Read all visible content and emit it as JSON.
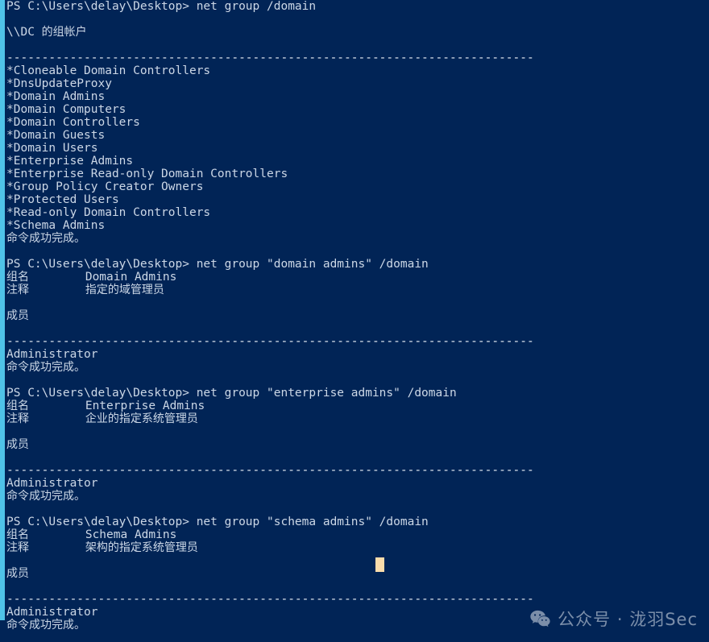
{
  "terminal": {
    "app": "Windows PowerShell",
    "prompt": "PS C:\\Users\\delay\\Desktop>",
    "background_color": "#012456",
    "foreground_color": "#ccd7e6",
    "highlight_strip_color": "#4fc3e8",
    "cursor_color": "#fadcab",
    "separator": "---------------------------------------------------------------------------",
    "lines": [
      "PS C:\\Users\\delay\\Desktop> net group /domain",
      "",
      "\\\\DC 的组帐户",
      "",
      "---------------------------------------------------------------------------",
      "*Cloneable Domain Controllers",
      "*DnsUpdateProxy",
      "*Domain Admins",
      "*Domain Computers",
      "*Domain Controllers",
      "*Domain Guests",
      "*Domain Users",
      "*Enterprise Admins",
      "*Enterprise Read-only Domain Controllers",
      "*Group Policy Creator Owners",
      "*Protected Users",
      "*Read-only Domain Controllers",
      "*Schema Admins",
      "命令成功完成。",
      "",
      "PS C:\\Users\\delay\\Desktop> net group \"domain admins\" /domain",
      "组名        Domain Admins",
      "注释        指定的域管理员",
      "",
      "成员",
      "",
      "---------------------------------------------------------------------------",
      "Administrator",
      "命令成功完成。",
      "",
      "PS C:\\Users\\delay\\Desktop> net group \"enterprise admins\" /domain",
      "组名        Enterprise Admins",
      "注释        企业的指定系统管理员",
      "",
      "成员",
      "",
      "---------------------------------------------------------------------------",
      "Administrator",
      "命令成功完成。",
      "",
      "PS C:\\Users\\delay\\Desktop> net group \"schema admins\" /domain",
      "组名        Schema Admins",
      "注释        架构的指定系统管理员",
      "",
      "成员",
      "",
      "---------------------------------------------------------------------------",
      "Administrator",
      "命令成功完成。"
    ],
    "commands": [
      "net group /domain",
      "net group \"domain admins\" /domain",
      "net group \"enterprise admins\" /domain",
      "net group \"schema admins\" /domain"
    ],
    "domain_groups": [
      "*Cloneable Domain Controllers",
      "*DnsUpdateProxy",
      "*Domain Admins",
      "*Domain Computers",
      "*Domain Controllers",
      "*Domain Guests",
      "*Domain Users",
      "*Enterprise Admins",
      "*Enterprise Read-only Domain Controllers",
      "*Group Policy Creator Owners",
      "*Protected Users",
      "*Read-only Domain Controllers",
      "*Schema Admins"
    ],
    "labels": {
      "group_accounts_header": "\\\\DC 的组帐户",
      "group_name": "组名",
      "comment": "注释",
      "members": "成员",
      "success": "命令成功完成。",
      "member_administrator": "Administrator"
    },
    "group_details": [
      {
        "group_name": "Domain Admins",
        "comment": "指定的域管理员",
        "members": [
          "Administrator"
        ]
      },
      {
        "group_name": "Enterprise Admins",
        "comment": "企业的指定系统管理员",
        "members": [
          "Administrator"
        ]
      },
      {
        "group_name": "Schema Admins",
        "comment": "架构的指定系统管理员",
        "members": [
          "Administrator"
        ]
      }
    ]
  },
  "watermark": {
    "icon": "wechat-icon",
    "text": "公众号 · 泷羽Sec",
    "color": "#c6cfdd"
  }
}
